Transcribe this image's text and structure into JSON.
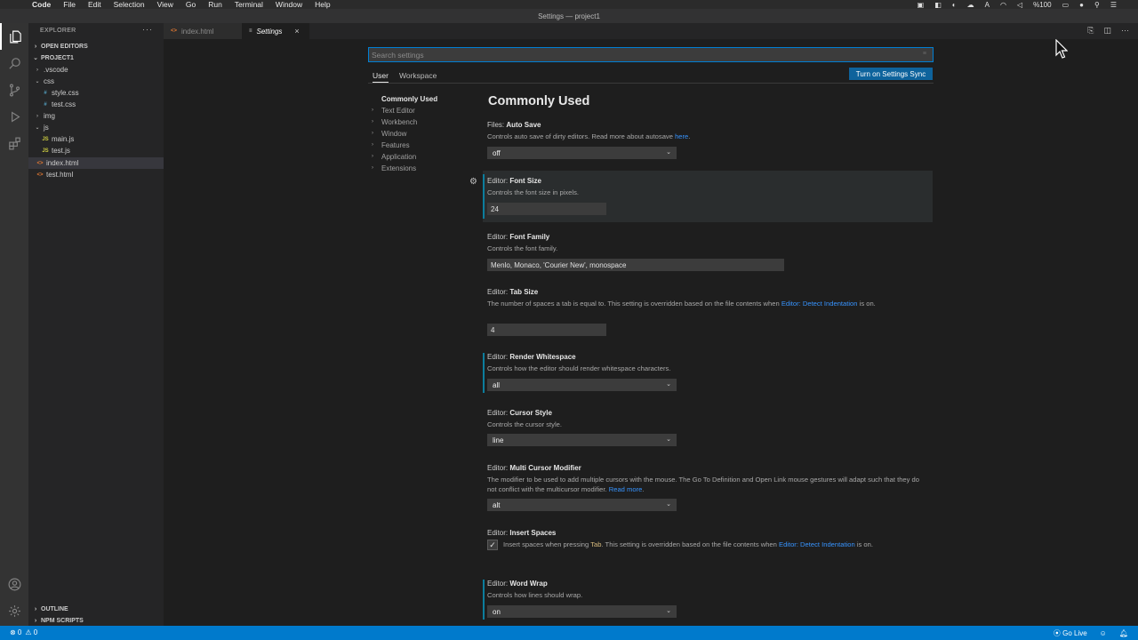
{
  "menubar": {
    "app": "Code",
    "items": [
      "File",
      "Edit",
      "Selection",
      "View",
      "Go",
      "Run",
      "Terminal",
      "Window",
      "Help"
    ],
    "battery": "%100"
  },
  "window": {
    "title": "Settings — project1"
  },
  "sidebar": {
    "title": "EXPLORER",
    "more": "···",
    "open_editors": "OPEN EDITORS",
    "project": "PROJECT1",
    "files": [
      {
        "name": ".vscode",
        "type": "folder",
        "icon": ""
      },
      {
        "name": "css",
        "type": "folder-open",
        "icon": ""
      },
      {
        "name": "style.css",
        "type": "css",
        "icon": "#"
      },
      {
        "name": "test.css",
        "type": "css",
        "icon": "#"
      },
      {
        "name": "img",
        "type": "folder",
        "icon": ""
      },
      {
        "name": "js",
        "type": "folder-open",
        "icon": ""
      },
      {
        "name": "main.js",
        "type": "js",
        "icon": "JS"
      },
      {
        "name": "test.js",
        "type": "js",
        "icon": "JS"
      },
      {
        "name": "index.html",
        "type": "html",
        "icon": "<>"
      },
      {
        "name": "test.html",
        "type": "html",
        "icon": "<>"
      }
    ],
    "outline": "OUTLINE",
    "npm_scripts": "NPM SCRIPTS"
  },
  "tabs": [
    {
      "label": "index.html",
      "icon": "<>"
    },
    {
      "label": "Settings",
      "icon": "≡",
      "close": "×"
    }
  ],
  "settings": {
    "search_placeholder": "Search settings",
    "search_clear": "≡",
    "scope_user": "User",
    "scope_workspace": "Workspace",
    "sync_button": "Turn on Settings Sync",
    "toc": [
      "Commonly Used",
      "Text Editor",
      "Workbench",
      "Window",
      "Features",
      "Application",
      "Extensions"
    ],
    "section_title": "Commonly Used",
    "items": {
      "auto_save": {
        "category": "Files: ",
        "name": "Auto Save",
        "desc": "Controls auto save of dirty editors. Read more about autosave ",
        "link": "here",
        "end": ".",
        "value": "off"
      },
      "font_size": {
        "category": "Editor: ",
        "name": "Font Size",
        "desc": "Controls the font size in pixels.",
        "value": "24"
      },
      "font_family": {
        "category": "Editor: ",
        "name": "Font Family",
        "desc": "Controls the font family.",
        "value": "Menlo, Monaco, 'Courier New', monospace"
      },
      "tab_size": {
        "category": "Editor: ",
        "name": "Tab Size",
        "desc": "The number of spaces a tab is equal to. This setting is overridden based on the file contents when ",
        "link": "Editor: Detect Indentation",
        "end": " is on.",
        "value": "4"
      },
      "render_whitespace": {
        "category": "Editor: ",
        "name": "Render Whitespace",
        "desc": "Controls how the editor should render whitespace characters.",
        "value": "all"
      },
      "cursor_style": {
        "category": "Editor: ",
        "name": "Cursor Style",
        "desc": "Controls the cursor style.",
        "value": "line"
      },
      "multi_cursor": {
        "category": "Editor: ",
        "name": "Multi Cursor Modifier",
        "desc": "The modifier to be used to add multiple cursors with the mouse. The Go To Definition and Open Link mouse gestures will adapt such that they do not conflict with the multicursor modifier. ",
        "link": "Read more",
        "end": ".",
        "value": "alt"
      },
      "insert_spaces": {
        "category": "Editor: ",
        "name": "Insert Spaces",
        "desc": "Insert spaces when pressing ",
        "code": "Tab",
        "desc2": ". This setting is overridden based on the file contents when ",
        "link": "Editor: Detect Indentation",
        "end": " is on.",
        "checked": "✓"
      },
      "word_wrap": {
        "category": "Editor: ",
        "name": "Word Wrap",
        "desc": "Controls how lines should wrap.",
        "value": "on"
      }
    }
  },
  "statusbar": {
    "errors": "⊗ 0",
    "warnings": "⚠ 0",
    "go_live": "Go Live"
  },
  "colors": {
    "accent": "#007acc",
    "button": "#0e639c",
    "link": "#3794ff",
    "modified": "#0c7d9d"
  }
}
